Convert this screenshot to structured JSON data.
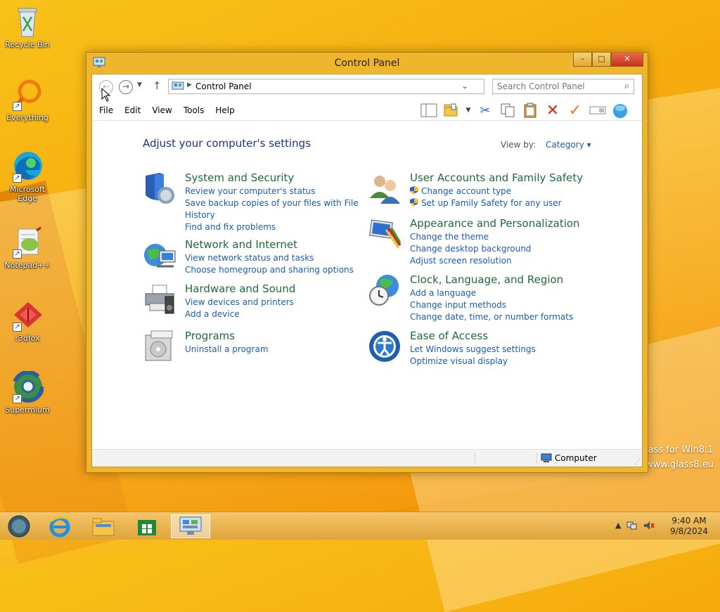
{
  "desktop": {
    "icons": [
      {
        "label": "Recycle Bin"
      },
      {
        "label": "Everything"
      },
      {
        "label": "Microsoft Edge"
      },
      {
        "label": "Notepad++"
      },
      {
        "label": "r3dfox"
      },
      {
        "label": "Supermium"
      }
    ],
    "watermark_line1": "lass for Win8.1",
    "watermark_line2": "www.glass8.eu"
  },
  "window": {
    "title": "Control Panel",
    "controls": {
      "minimize": "–",
      "maximize": "□",
      "close": "✕"
    },
    "address": {
      "crumb": "Control Panel"
    },
    "search": {
      "placeholder": "Search Control Panel"
    },
    "menu": [
      "File",
      "Edit",
      "View",
      "Tools",
      "Help"
    ],
    "heading": "Adjust your computer's settings",
    "view_by": {
      "label": "View by:",
      "value": "Category ▾"
    },
    "categories": [
      {
        "title": "System and Security",
        "icon": "shield-icon",
        "links": [
          "Review your computer's status",
          "Save backup copies of your files with File",
          "History",
          "Find and fix problems"
        ]
      },
      {
        "title": "Network and Internet",
        "icon": "network-icon",
        "links": [
          "View network status and tasks",
          "Choose homegroup and sharing options"
        ]
      },
      {
        "title": "Hardware and Sound",
        "icon": "printer-icon",
        "links": [
          "View devices and printers",
          "Add a device"
        ]
      },
      {
        "title": "Programs",
        "icon": "programs-icon",
        "links": [
          "Uninstall a program"
        ]
      },
      {
        "title": "User Accounts and Family Safety",
        "icon": "users-icon",
        "links": [
          "Change account type",
          "Set up Family Safety for any user"
        ]
      },
      {
        "title": "Appearance and Personalization",
        "icon": "appearance-icon",
        "links": [
          "Change the theme",
          "Change desktop background",
          "Adjust screen resolution"
        ]
      },
      {
        "title": "Clock, Language, and Region",
        "icon": "clock-globe-icon",
        "links": [
          "Add a language",
          "Change input methods",
          "Change date, time, or number formats"
        ]
      },
      {
        "title": "Ease of Access",
        "icon": "ease-of-access-icon",
        "links": [
          "Let Windows suggest settings",
          "Optimize visual display"
        ]
      }
    ],
    "status": {
      "location": "Computer"
    }
  },
  "taskbar": {
    "time": "9:40 AM",
    "date": "9/8/2024"
  }
}
